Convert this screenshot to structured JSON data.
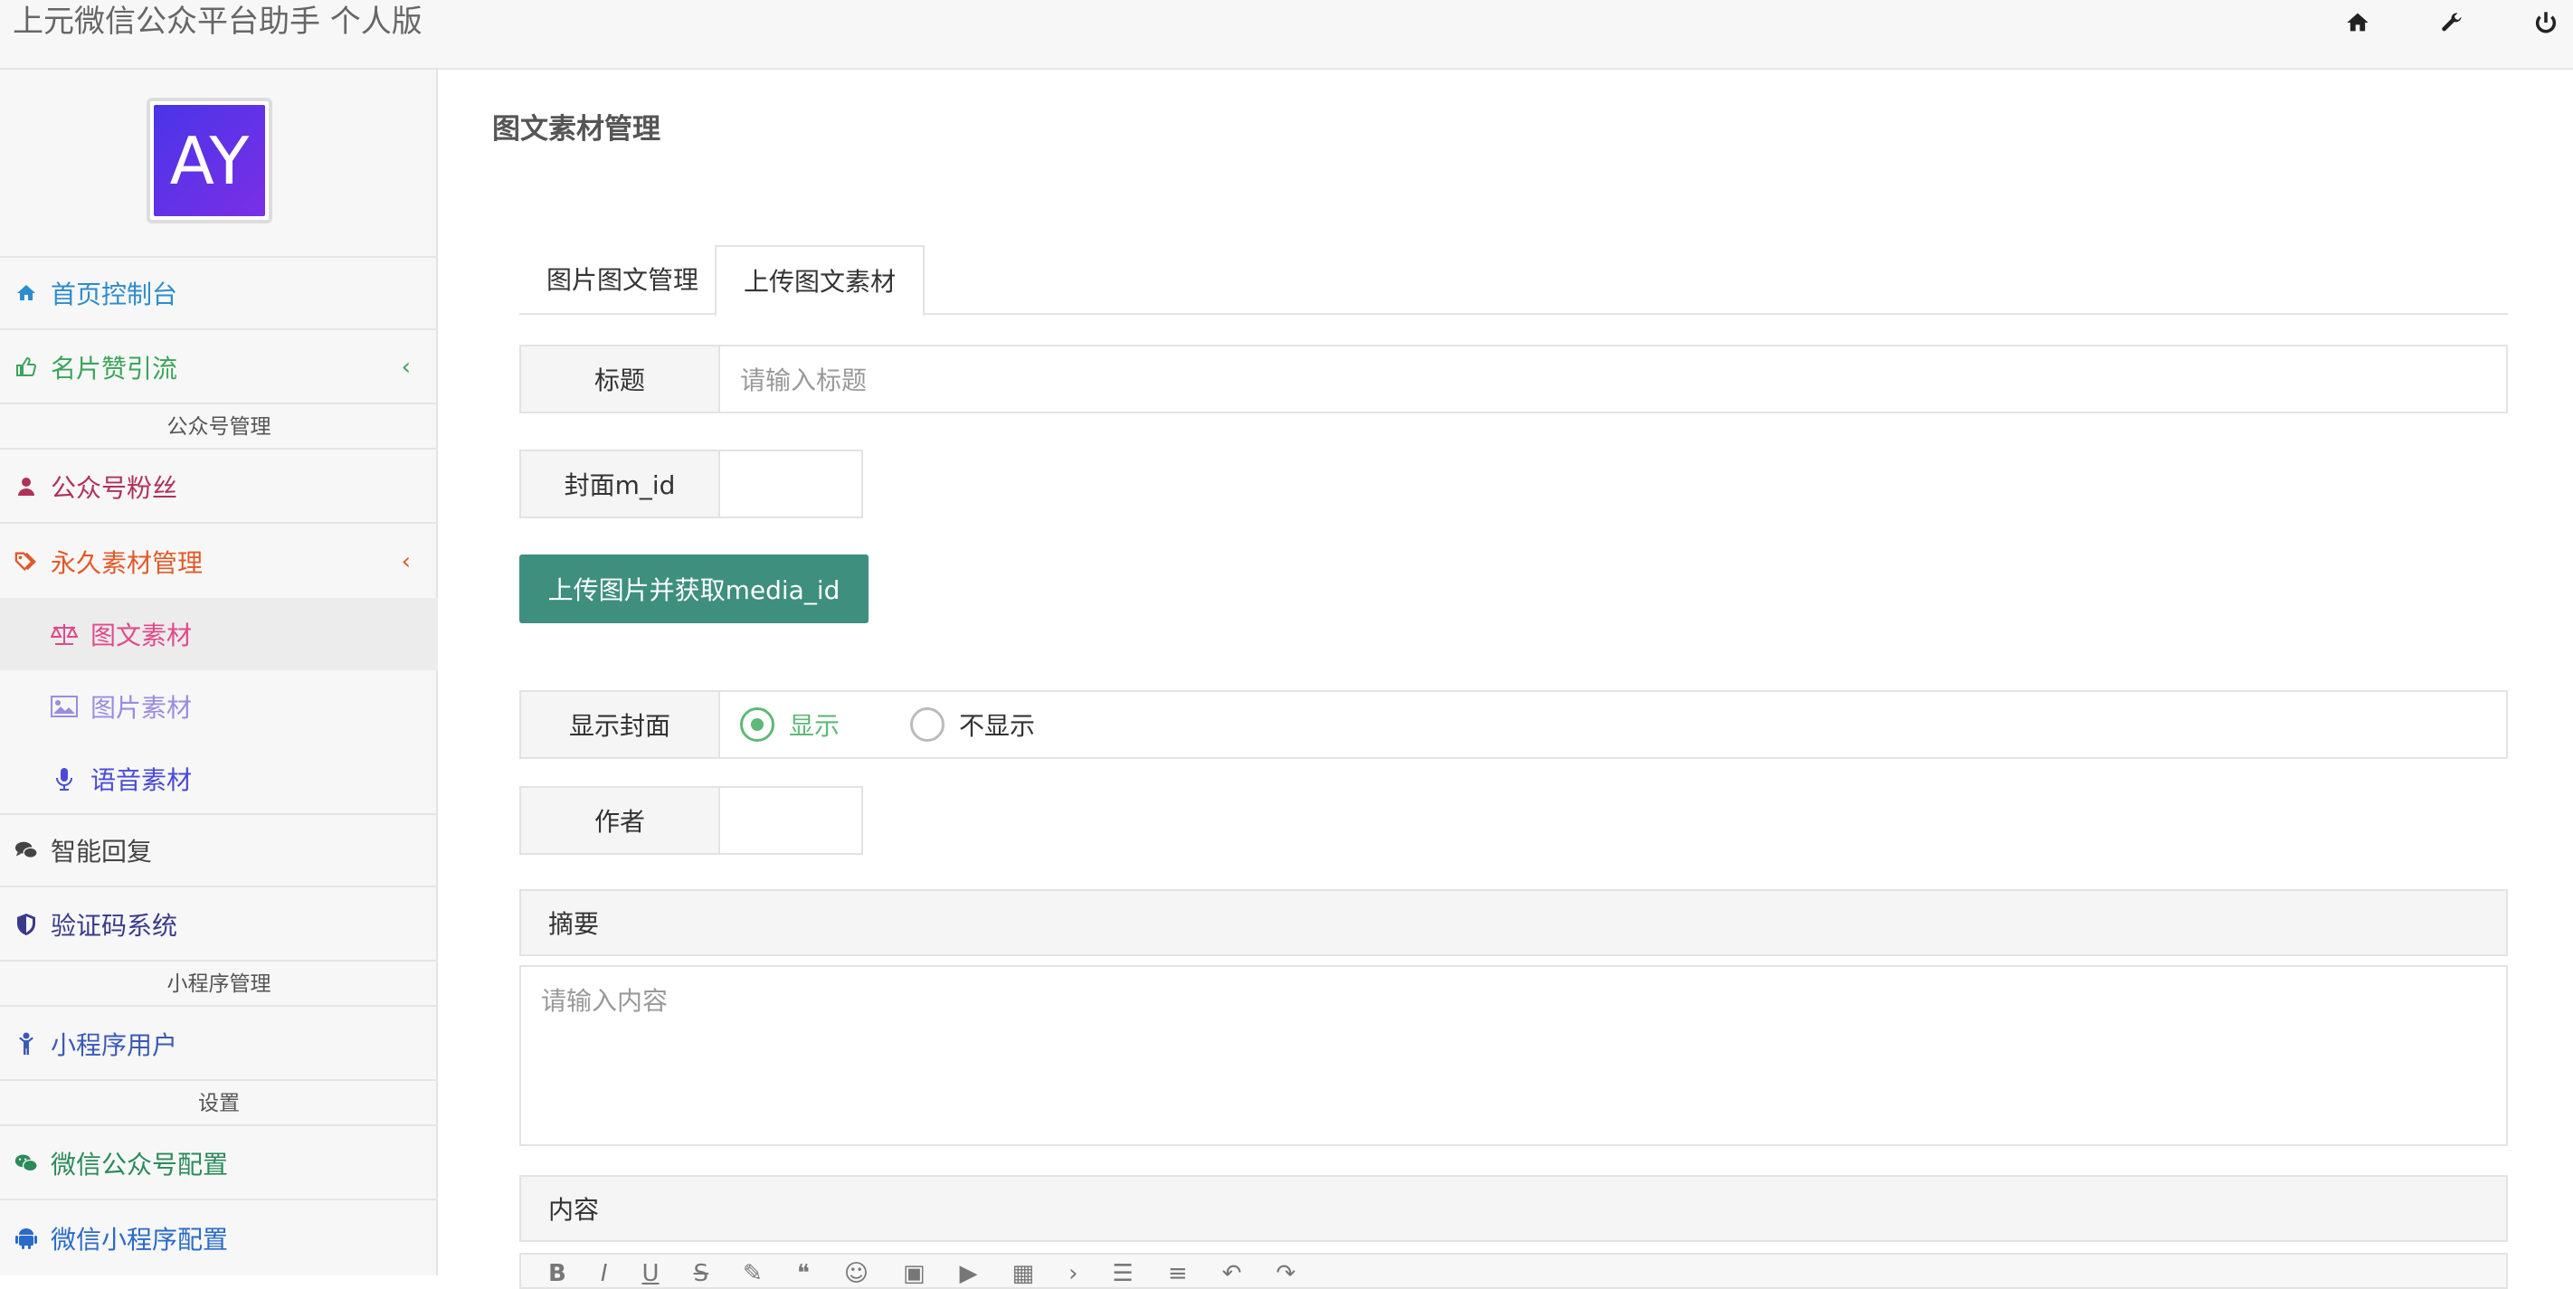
{
  "app": {
    "title": "上元微信公众平台助手 个人版"
  },
  "topbar": {
    "icons": [
      "home-icon",
      "wrench-icon",
      "power-icon"
    ]
  },
  "sidebar": {
    "avatar_text": "AY",
    "items": [
      {
        "label": "首页控制台",
        "icon": "home-icon",
        "color": "#2d8ccc"
      },
      {
        "label": "名片赞引流",
        "icon": "thumbs-up-icon",
        "color": "#3aa55a",
        "chevron": "‹"
      },
      {
        "header": "公众号管理"
      },
      {
        "label": "公众号粉丝",
        "icon": "user-icon",
        "color": "#b0315a"
      },
      {
        "label": "永久素材管理",
        "icon": "tags-icon",
        "color": "#e05a2a",
        "chevron": "‹"
      },
      {
        "label": "图文素材",
        "icon": "balance-icon",
        "color": "#e04a8a"
      },
      {
        "label": "图片素材",
        "icon": "image-icon",
        "color": "#9a8ce0"
      },
      {
        "label": "语音素材",
        "icon": "mic-icon",
        "color": "#4a4ad8"
      },
      {
        "label": "智能回复",
        "icon": "comments-icon",
        "color": "#444444"
      },
      {
        "label": "验证码系统",
        "icon": "shield-icon",
        "color": "#3a3a8a"
      },
      {
        "header": "小程序管理"
      },
      {
        "label": "小程序用户",
        "icon": "child-icon",
        "color": "#3a5ab8"
      },
      {
        "header": "设置"
      },
      {
        "label": "微信公众号配置",
        "icon": "wechat-icon",
        "color": "#2a8a5a"
      },
      {
        "label": "微信小程序配置",
        "icon": "android-icon",
        "color": "#2a6ac8"
      }
    ]
  },
  "main": {
    "page_title": "图文素材管理",
    "tabs": [
      {
        "label": "图片图文管理"
      },
      {
        "label": "上传图文素材",
        "active": true
      }
    ],
    "form": {
      "title_label": "标题",
      "title_placeholder": "请输入标题",
      "cover_label": "封面m_id",
      "upload_button": "上传图片并获取media_id",
      "show_cover_label": "显示封面",
      "show_option": "显示",
      "hide_option": "不显示",
      "author_label": "作者",
      "summary_label": "摘要",
      "summary_placeholder": "请输入内容",
      "content_label": "内容"
    }
  },
  "colors": {
    "accent": "#3e8f7e",
    "radio_on": "#5fb878"
  }
}
